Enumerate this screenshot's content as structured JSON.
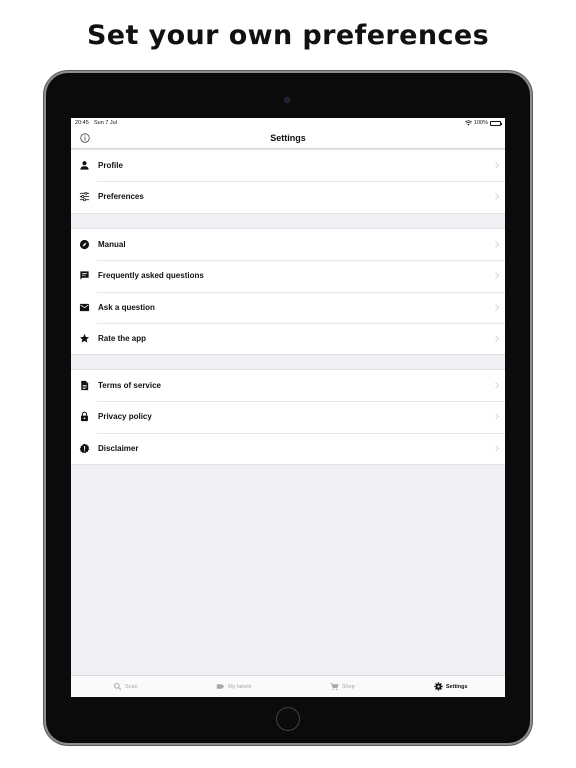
{
  "headline": "Set your own preferences",
  "status_bar": {
    "time": "20:45",
    "date": "Sun 7 Jul",
    "battery": "100%"
  },
  "nav": {
    "title": "Settings"
  },
  "groups": [
    {
      "items": [
        {
          "label": "Profile",
          "icon": "person-icon"
        },
        {
          "label": "Preferences",
          "icon": "sliders-icon"
        }
      ]
    },
    {
      "items": [
        {
          "label": "Manual",
          "icon": "compass-icon"
        },
        {
          "label": "Frequently asked questions",
          "icon": "chat-bubble-icon"
        },
        {
          "label": "Ask a question",
          "icon": "envelope-icon"
        },
        {
          "label": "Rate the app",
          "icon": "star-icon"
        }
      ]
    },
    {
      "items": [
        {
          "label": "Terms of service",
          "icon": "document-icon"
        },
        {
          "label": "Privacy policy",
          "icon": "lock-icon"
        },
        {
          "label": "Disclaimer",
          "icon": "alert-badge-icon"
        }
      ]
    }
  ],
  "tabs": [
    {
      "label": "Scan",
      "icon": "search-icon",
      "active": false
    },
    {
      "label": "My labels",
      "icon": "label-icon",
      "active": false
    },
    {
      "label": "Shop",
      "icon": "cart-icon",
      "active": false
    },
    {
      "label": "Settings",
      "icon": "gear-icon",
      "active": true
    }
  ],
  "colors": {
    "background": "#efeff4",
    "text": "#111111",
    "inactive_tab": "#a8a8ad",
    "device": "#0b0b0b"
  }
}
